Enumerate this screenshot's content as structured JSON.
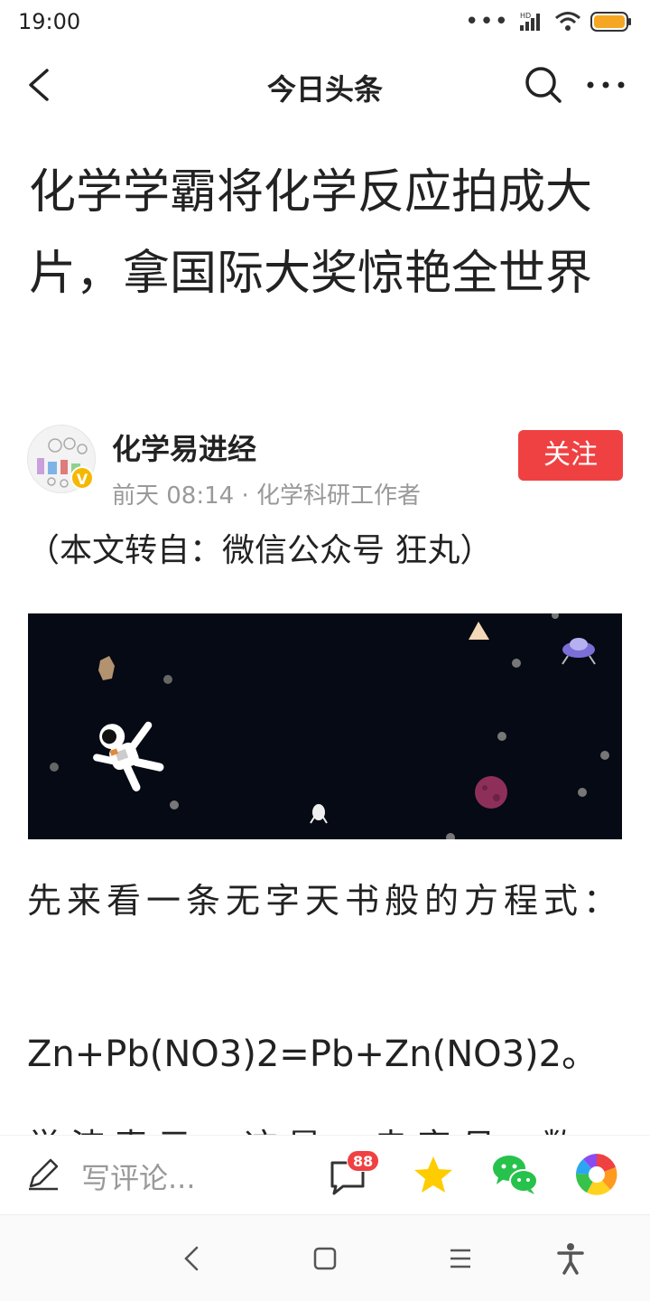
{
  "status_bar": {
    "time": "19:00",
    "signal_label": "HD"
  },
  "nav": {
    "title": "今日头条"
  },
  "article": {
    "title": "化学学霸将化学反应拍成大片，拿国际大奖惊艳全世界",
    "author": {
      "name": "化学易进经",
      "verified_badge": "V",
      "meta": "前天 08:14 · 化学科研工作者",
      "follow_label": "关注"
    },
    "source_note": "（本文转自：微信公众号 狂丸）",
    "paragraphs": [
      "先来看一条无字天书般的方程式：",
      "Zn+Pb(NO3)2=Pb+Zn(NO3)2。",
      "学渣表示，这是一串字母+数字"
    ]
  },
  "comment_bar": {
    "placeholder": "写评论...",
    "comment_count": "88"
  },
  "colors": {
    "accent": "#f04142",
    "battery": "#f5a623",
    "star": "#ffcc00",
    "wechat": "#27c24c",
    "image_bg": "#050a14"
  }
}
